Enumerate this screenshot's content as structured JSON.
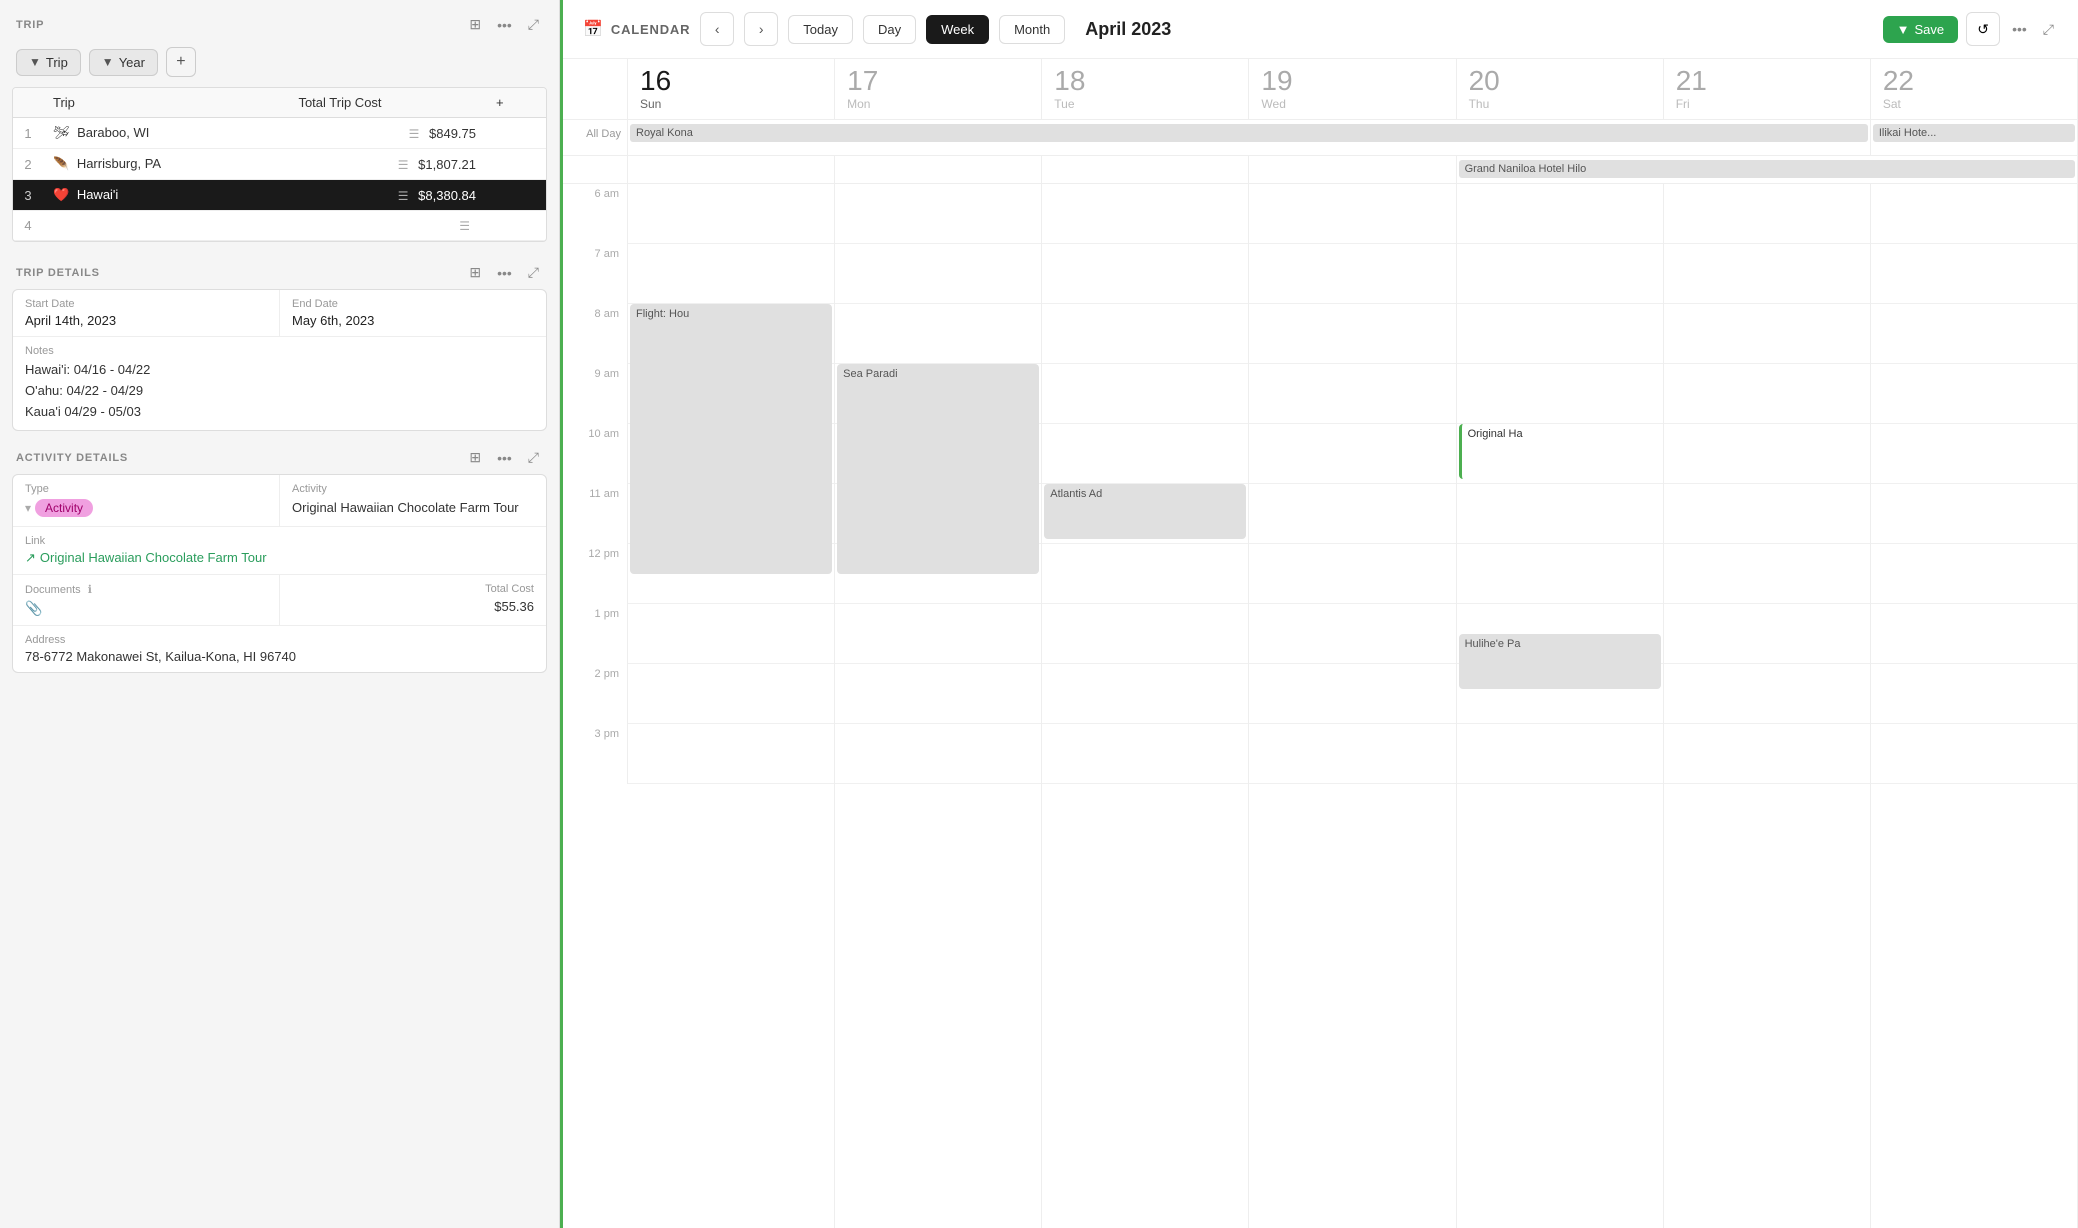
{
  "left": {
    "trip_section_title": "TRIP",
    "filter_trip_label": "Trip",
    "filter_year_label": "Year",
    "trips": [
      {
        "num": 1,
        "emoji": "🛩",
        "name": "Baraboo, WI",
        "cost": "$849.75",
        "selected": false
      },
      {
        "num": 2,
        "emoji": "🪶",
        "name": "Harrisburg, PA",
        "cost": "$1,807.21",
        "selected": false
      },
      {
        "num": 3,
        "emoji": "❤️",
        "name": "Hawai'i",
        "cost": "$8,380.84",
        "selected": true
      },
      {
        "num": 4,
        "emoji": "",
        "name": "",
        "cost": "",
        "selected": false
      }
    ],
    "trip_details_title": "TRIP DETAILS",
    "start_date_label": "Start Date",
    "start_date_value": "April 14th, 2023",
    "end_date_label": "End Date",
    "end_date_value": "May 6th, 2023",
    "notes_label": "Notes",
    "notes_lines": [
      "Hawai'i: 04/16 - 04/22",
      "O'ahu: 04/22 - 04/29",
      "Kaua'i 04/29 - 05/03"
    ],
    "activity_details_title": "ACTIVITY DETAILS",
    "type_label": "Type",
    "type_value": "Activity",
    "activity_label": "Activity",
    "activity_value": "Original Hawaiian Chocolate Farm Tour",
    "link_label": "Link",
    "link_value": "Original Hawaiian Chocolate Farm Tour",
    "documents_label": "Documents",
    "total_cost_label": "Total Cost",
    "total_cost_value": "$55.36",
    "address_label": "Address",
    "address_value": "78-6772 Makonawei St, Kailua-Kona, HI 96740"
  },
  "right": {
    "app_title": "CALENDAR",
    "app_emoji": "📅",
    "save_label": "Save",
    "nav_prev": "‹",
    "nav_next": "›",
    "today_label": "Today",
    "day_label": "Day",
    "week_label": "Week",
    "month_label": "Month",
    "month_year": "April 2023",
    "days": [
      {
        "num": "16",
        "name": "Sun",
        "today": true
      },
      {
        "num": "17",
        "name": "Mon",
        "today": false
      },
      {
        "num": "18",
        "name": "Tue",
        "today": false
      },
      {
        "num": "19",
        "name": "Wed",
        "today": false
      },
      {
        "num": "20",
        "name": "Thu",
        "today": false
      },
      {
        "num": "21",
        "name": "Fri",
        "today": false
      },
      {
        "num": "22",
        "name": "Sat",
        "today": false
      }
    ],
    "all_day_label": "All Day",
    "hotel_bars": [
      {
        "col": 0,
        "span": 6,
        "label": "Royal Kona"
      },
      {
        "col": 6,
        "span": 1,
        "label": "Ilikai Hote..."
      }
    ],
    "grand_naniloa": {
      "col": 4,
      "span": 3,
      "label": "Grand Naniloa Hotel Hilo"
    },
    "time_slots": [
      "6 am",
      "7 am",
      "8 am",
      "9 am",
      "10 am",
      "11 am",
      "12 pm",
      "1 pm",
      "2 pm",
      "3 pm"
    ],
    "events": [
      {
        "col": 0,
        "top_slot": 2,
        "top_offset": 0,
        "height_slots": 4.5,
        "label": "Flight: Hou",
        "type": "gray"
      },
      {
        "col": 1,
        "top_slot": 3,
        "top_offset": 0,
        "height_slots": 3.5,
        "label": "Sea Paradi",
        "type": "gray"
      },
      {
        "col": 2,
        "top_slot": 5,
        "top_offset": 0,
        "height_slots": 1,
        "label": "Atlantis Ad",
        "type": "gray"
      },
      {
        "col": 3,
        "top_slot": 4,
        "top_offset": 0,
        "height_slots": 1,
        "label": "Original Ha",
        "type": "green"
      },
      {
        "col": 3,
        "top_slot": 6.5,
        "top_offset": 0,
        "height_slots": 1,
        "label": "Hulihe'e Pa",
        "type": "gray"
      }
    ]
  }
}
